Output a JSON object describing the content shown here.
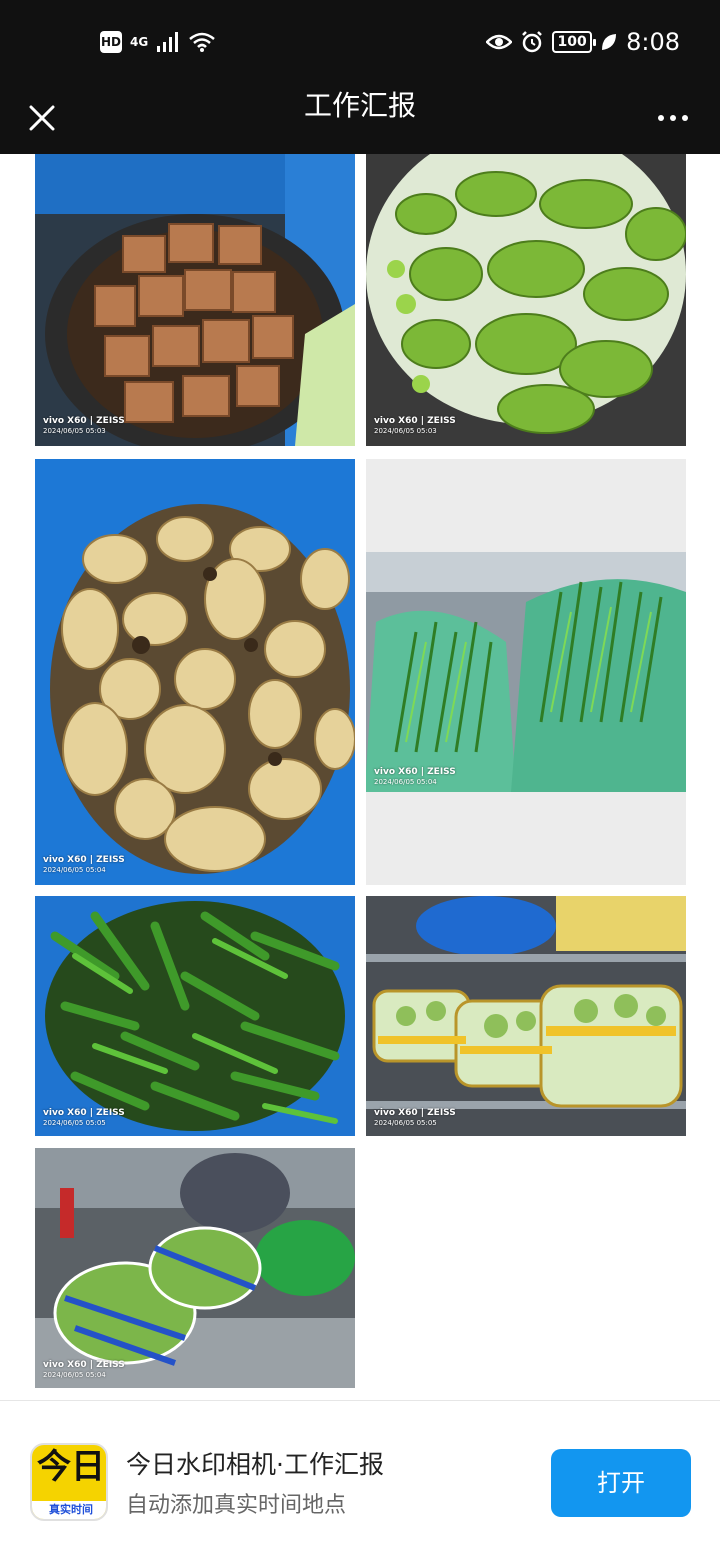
{
  "status_bar": {
    "hd_badge": "HD",
    "network": "4G",
    "battery": "100",
    "time": "8:08",
    "icons": [
      "signal-icon",
      "wifi-icon",
      "eye-icon",
      "alarm-icon",
      "battery-icon",
      "leaf-icon"
    ]
  },
  "header": {
    "title": "工作汇报",
    "close_icon": "close-icon",
    "more_icon": "more-icon"
  },
  "photos": [
    {
      "subject": "tofu",
      "camera": "vivo X60 | ZEISS",
      "timestamp": "2024/06/05 05:03"
    },
    {
      "subject": "green-peppers-in-bag",
      "camera": "vivo X60 | ZEISS",
      "timestamp": "2024/06/05 05:03"
    },
    {
      "subject": "lotus-root",
      "camera": "vivo X60 | ZEISS",
      "timestamp": "2024/06/05 05:04"
    },
    {
      "subject": "chives-in-bags",
      "camera": "vivo X60 | ZEISS",
      "timestamp": "2024/06/05 05:04"
    },
    {
      "subject": "chili-peppers",
      "camera": "vivo X60 | ZEISS",
      "timestamp": "2024/06/05 05:05"
    },
    {
      "subject": "cabbage-on-shelf",
      "camera": "vivo X60 | ZEISS",
      "timestamp": "2024/06/05 05:05"
    },
    {
      "subject": "bagged-vegetables",
      "camera": "vivo X60 | ZEISS",
      "timestamp": "2024/06/05 05:04"
    }
  ],
  "banner": {
    "app_icon_text": "今日",
    "app_icon_strip": "真实时间",
    "app_name": "今日水印相机·工作汇报",
    "app_desc": "自动添加真实时间地点",
    "open_label": "打开",
    "accent": "#1296f0",
    "icon_color": "#f5d300"
  }
}
